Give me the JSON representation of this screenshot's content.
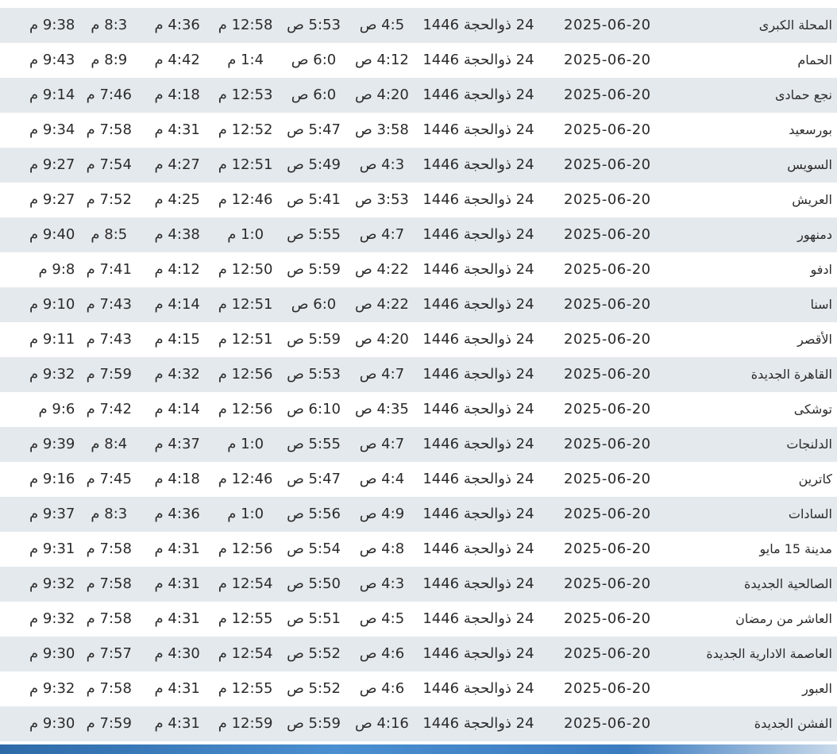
{
  "rows": [
    {
      "city": "المحلة الكبرى",
      "gregorian": "2025-06-20",
      "hijri": "24 ذوالحجة 1446",
      "fajr": "4:5 ص",
      "sunrise": "5:53 ص",
      "dhuhr": "12:58 م",
      "asr": "4:36 م",
      "maghrib": "8:3 م",
      "isha": "9:38 م"
    },
    {
      "city": "الحمام",
      "gregorian": "2025-06-20",
      "hijri": "24 ذوالحجة 1446",
      "fajr": "4:12 ص",
      "sunrise": "6:0 ص",
      "dhuhr": "1:4 م",
      "asr": "4:42 م",
      "maghrib": "8:9 م",
      "isha": "9:43 م"
    },
    {
      "city": "نجع حمادى",
      "gregorian": "2025-06-20",
      "hijri": "24 ذوالحجة 1446",
      "fajr": "4:20 ص",
      "sunrise": "6:0 ص",
      "dhuhr": "12:53 م",
      "asr": "4:18 م",
      "maghrib": "7:46 م",
      "isha": "9:14 م"
    },
    {
      "city": "بورسعيد",
      "gregorian": "2025-06-20",
      "hijri": "24 ذوالحجة 1446",
      "fajr": "3:58 ص",
      "sunrise": "5:47 ص",
      "dhuhr": "12:52 م",
      "asr": "4:31 م",
      "maghrib": "7:58 م",
      "isha": "9:34 م"
    },
    {
      "city": "السويس",
      "gregorian": "2025-06-20",
      "hijri": "24 ذوالحجة 1446",
      "fajr": "4:3 ص",
      "sunrise": "5:49 ص",
      "dhuhr": "12:51 م",
      "asr": "4:27 م",
      "maghrib": "7:54 م",
      "isha": "9:27 م"
    },
    {
      "city": "العريش",
      "gregorian": "2025-06-20",
      "hijri": "24 ذوالحجة 1446",
      "fajr": "3:53 ص",
      "sunrise": "5:41 ص",
      "dhuhr": "12:46 م",
      "asr": "4:25 م",
      "maghrib": "7:52 م",
      "isha": "9:27 م"
    },
    {
      "city": "دمنهور",
      "gregorian": "2025-06-20",
      "hijri": "24 ذوالحجة 1446",
      "fajr": "4:7 ص",
      "sunrise": "5:55 ص",
      "dhuhr": "1:0 م",
      "asr": "4:38 م",
      "maghrib": "8:5 م",
      "isha": "9:40 م"
    },
    {
      "city": "ادفو",
      "gregorian": "2025-06-20",
      "hijri": "24 ذوالحجة 1446",
      "fajr": "4:22 ص",
      "sunrise": "5:59 ص",
      "dhuhr": "12:50 م",
      "asr": "4:12 م",
      "maghrib": "7:41 م",
      "isha": "9:8 م"
    },
    {
      "city": "اسنا",
      "gregorian": "2025-06-20",
      "hijri": "24 ذوالحجة 1446",
      "fajr": "4:22 ص",
      "sunrise": "6:0 ص",
      "dhuhr": "12:51 م",
      "asr": "4:14 م",
      "maghrib": "7:43 م",
      "isha": "9:10 م"
    },
    {
      "city": "الأقصر",
      "gregorian": "2025-06-20",
      "hijri": "24 ذوالحجة 1446",
      "fajr": "4:20 ص",
      "sunrise": "5:59 ص",
      "dhuhr": "12:51 م",
      "asr": "4:15 م",
      "maghrib": "7:43 م",
      "isha": "9:11 م"
    },
    {
      "city": "القاهرة الجديدة",
      "gregorian": "2025-06-20",
      "hijri": "24 ذوالحجة 1446",
      "fajr": "4:7 ص",
      "sunrise": "5:53 ص",
      "dhuhr": "12:56 م",
      "asr": "4:32 م",
      "maghrib": "7:59 م",
      "isha": "9:32 م"
    },
    {
      "city": "توشكى",
      "gregorian": "2025-06-20",
      "hijri": "24 ذوالحجة 1446",
      "fajr": "4:35 ص",
      "sunrise": "6:10 ص",
      "dhuhr": "12:56 م",
      "asr": "4:14 م",
      "maghrib": "7:42 م",
      "isha": "9:6 م"
    },
    {
      "city": "الدلنجات",
      "gregorian": "2025-06-20",
      "hijri": "24 ذوالحجة 1446",
      "fajr": "4:7 ص",
      "sunrise": "5:55 ص",
      "dhuhr": "1:0 م",
      "asr": "4:37 م",
      "maghrib": "8:4 م",
      "isha": "9:39 م"
    },
    {
      "city": "كاترين",
      "gregorian": "2025-06-20",
      "hijri": "24 ذوالحجة 1446",
      "fajr": "4:4 ص",
      "sunrise": "5:47 ص",
      "dhuhr": "12:46 م",
      "asr": "4:18 م",
      "maghrib": "7:45 م",
      "isha": "9:16 م"
    },
    {
      "city": "السادات",
      "gregorian": "2025-06-20",
      "hijri": "24 ذوالحجة 1446",
      "fajr": "4:9 ص",
      "sunrise": "5:56 ص",
      "dhuhr": "1:0 م",
      "asr": "4:36 م",
      "maghrib": "8:3 م",
      "isha": "9:37 م"
    },
    {
      "city": "مدينة 15 مايو",
      "gregorian": "2025-06-20",
      "hijri": "24 ذوالحجة 1446",
      "fajr": "4:8 ص",
      "sunrise": "5:54 ص",
      "dhuhr": "12:56 م",
      "asr": "4:31 م",
      "maghrib": "7:58 م",
      "isha": "9:31 م"
    },
    {
      "city": "الصالحية الجديدة",
      "gregorian": "2025-06-20",
      "hijri": "24 ذوالحجة 1446",
      "fajr": "4:3 ص",
      "sunrise": "5:50 ص",
      "dhuhr": "12:54 م",
      "asr": "4:31 م",
      "maghrib": "7:58 م",
      "isha": "9:32 م"
    },
    {
      "city": "العاشر من رمضان",
      "gregorian": "2025-06-20",
      "hijri": "24 ذوالحجة 1446",
      "fajr": "4:5 ص",
      "sunrise": "5:51 ص",
      "dhuhr": "12:55 م",
      "asr": "4:31 م",
      "maghrib": "7:58 م",
      "isha": "9:32 م"
    },
    {
      "city": "العاصمة الادارية الجديدة",
      "gregorian": "2025-06-20",
      "hijri": "24 ذوالحجة 1446",
      "fajr": "4:6 ص",
      "sunrise": "5:52 ص",
      "dhuhr": "12:54 م",
      "asr": "4:30 م",
      "maghrib": "7:57 م",
      "isha": "9:30 م"
    },
    {
      "city": "العبور",
      "gregorian": "2025-06-20",
      "hijri": "24 ذوالحجة 1446",
      "fajr": "4:6 ص",
      "sunrise": "5:52 ص",
      "dhuhr": "12:55 م",
      "asr": "4:31 م",
      "maghrib": "7:58 م",
      "isha": "9:32 م"
    },
    {
      "city": "الفشن الجديدة",
      "gregorian": "2025-06-20",
      "hijri": "24 ذوالحجة 1446",
      "fajr": "4:16 ص",
      "sunrise": "5:59 ص",
      "dhuhr": "12:59 م",
      "asr": "4:31 م",
      "maghrib": "7:59 م",
      "isha": "9:30 م"
    }
  ],
  "colors": {
    "row_alt": "#e4e9ed",
    "row_plain": "#ffffff",
    "text": "#2b2b2b",
    "bottom_bar": "#3b7cc0"
  }
}
